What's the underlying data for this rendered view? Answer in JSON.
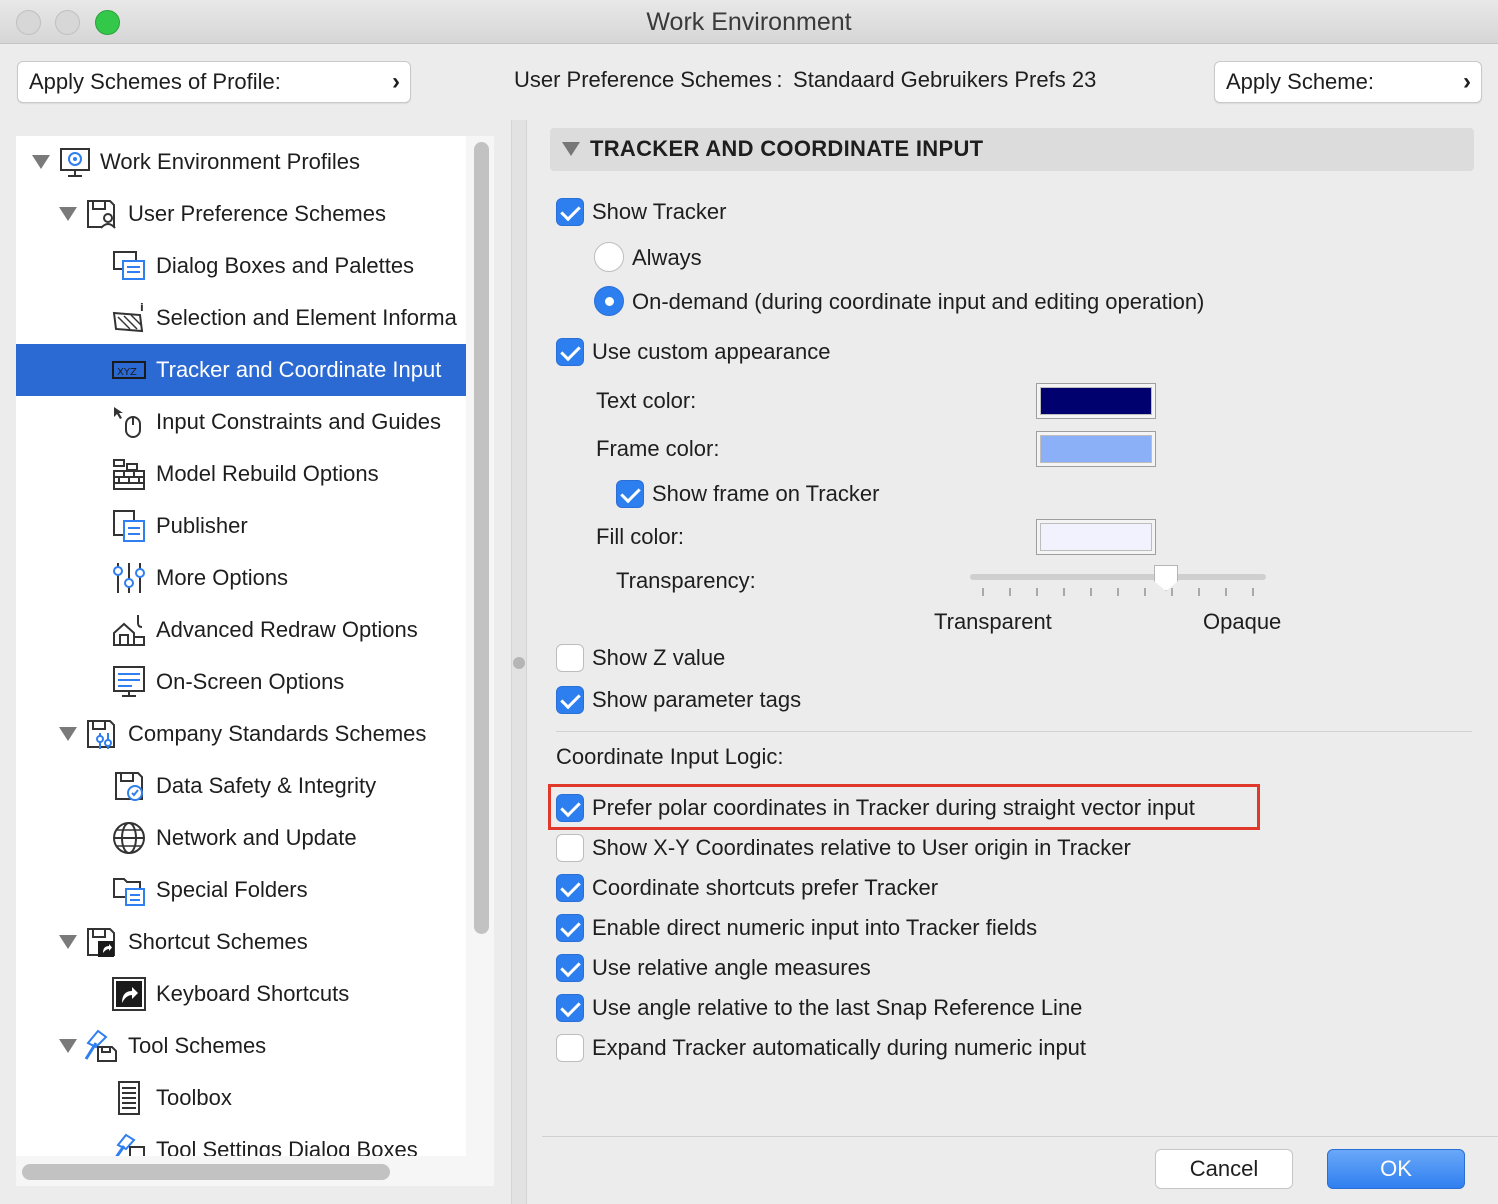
{
  "window": {
    "title": "Work Environment"
  },
  "topbar": {
    "apply_profile_label": "Apply Schemes of Profile:",
    "scheme_caption": "User Preference Schemes :  Standaard Gebruikers Prefs 23",
    "apply_scheme_label": "Apply Scheme:",
    "chevron": "›"
  },
  "tree": {
    "items": [
      {
        "label": "Work Environment Profiles",
        "icon": "profiles-icon"
      },
      {
        "label": "User Preference Schemes",
        "icon": "user-scheme-icon"
      },
      {
        "label": "Dialog Boxes and Palettes",
        "icon": "dialog-boxes-icon"
      },
      {
        "label": "Selection and Element Informa",
        "icon": "selection-icon"
      },
      {
        "label": "Tracker and Coordinate Input",
        "icon": "xyz-tracker-icon"
      },
      {
        "label": "Input Constraints and Guides",
        "icon": "mouse-icon"
      },
      {
        "label": "Model Rebuild Options",
        "icon": "brick-wall-icon"
      },
      {
        "label": "Publisher",
        "icon": "publisher-icon"
      },
      {
        "label": "More Options",
        "icon": "sliders-icon"
      },
      {
        "label": "Advanced Redraw Options",
        "icon": "redraw-icon"
      },
      {
        "label": "On-Screen Options",
        "icon": "screen-icon"
      },
      {
        "label": "Company Standards Schemes",
        "icon": "company-scheme-icon"
      },
      {
        "label": "Data Safety & Integrity",
        "icon": "data-safety-icon"
      },
      {
        "label": "Network and Update",
        "icon": "globe-icon"
      },
      {
        "label": "Special Folders",
        "icon": "folder-icon"
      },
      {
        "label": "Shortcut Schemes",
        "icon": "shortcut-scheme-icon"
      },
      {
        "label": "Keyboard Shortcuts",
        "icon": "keyboard-shortcut-icon"
      },
      {
        "label": "Tool Schemes",
        "icon": "tool-scheme-icon"
      },
      {
        "label": "Toolbox",
        "icon": "toolbox-icon"
      },
      {
        "label": "Tool Settings Dialog Boxes",
        "icon": "tool-settings-icon"
      }
    ]
  },
  "panel": {
    "section_title": "TRACKER AND COORDINATE INPUT",
    "show_tracker": "Show Tracker",
    "always": "Always",
    "on_demand": "On-demand (during coordinate input and editing operation)",
    "use_custom": "Use custom appearance",
    "text_color_label": "Text color:",
    "frame_color_label": "Frame color:",
    "show_frame": "Show frame on Tracker",
    "fill_color_label": "Fill color:",
    "transparency_label": "Transparency:",
    "transparent": "Transparent",
    "opaque": "Opaque",
    "show_z": "Show Z value",
    "show_param_tags": "Show parameter tags",
    "coord_logic_title": "Coordinate Input Logic:",
    "opt_polar": "Prefer polar coordinates in Tracker during straight vector input",
    "opt_xy": "Show X-Y Coordinates relative to User origin in Tracker",
    "opt_shortcuts": "Coordinate shortcuts prefer Tracker",
    "opt_direct": "Enable direct numeric input into Tracker fields",
    "opt_relative_angle": "Use relative angle measures",
    "opt_snap_angle": "Use angle relative to the last Snap Reference Line",
    "opt_expand": "Expand Tracker automatically during numeric input"
  },
  "colors": {
    "text_color": "#00006e",
    "frame_color": "#8cb0f8",
    "fill_color": "#f2f2ff",
    "selection": "#2c6ad3",
    "checkbox_on": "#2d7ff0",
    "highlight": "#e0392b"
  },
  "state": {
    "show_tracker": true,
    "on_demand": true,
    "use_custom": true,
    "show_frame": true,
    "show_z": false,
    "show_param_tags": true,
    "opt_polar": true,
    "opt_xy": false,
    "opt_shortcuts": true,
    "opt_direct": true,
    "opt_relative_angle": true,
    "opt_snap_angle": true,
    "opt_expand": false,
    "transparency_level": 0.67
  },
  "footer": {
    "cancel": "Cancel",
    "ok": "OK"
  }
}
